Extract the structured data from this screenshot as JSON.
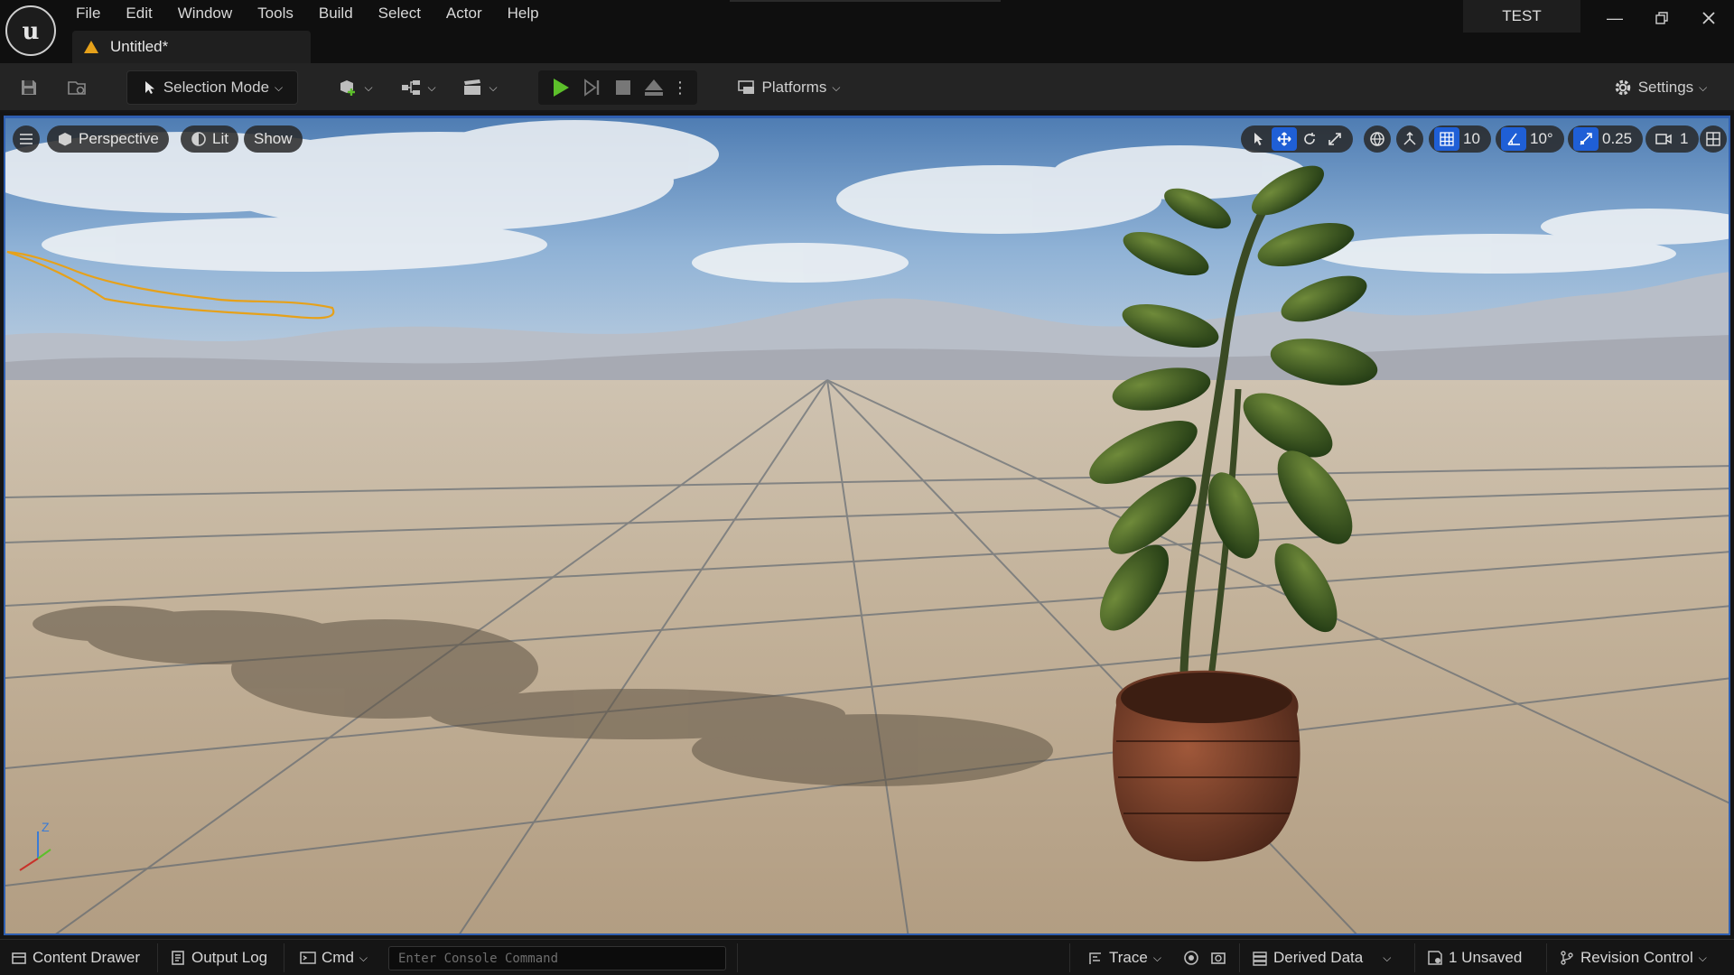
{
  "app": {
    "logo_icon": "unreal-engine-logo-icon",
    "menu": [
      "File",
      "Edit",
      "Window",
      "Tools",
      "Build",
      "Select",
      "Actor",
      "Help"
    ],
    "document_tab": "Untitled*",
    "project_name": "TEST",
    "window_controls": [
      "minimize-icon",
      "restore-icon",
      "close-icon"
    ]
  },
  "toolbar": {
    "selection_mode": "Selection Mode",
    "platforms": "Platforms",
    "settings": "Settings",
    "play_color": "#5cbf2a"
  },
  "viewport": {
    "view_mode_button": "Perspective",
    "lighting_button": "Lit",
    "show_button": "Show",
    "grid_snap_value": "10",
    "rotation_snap_value": "10°",
    "scale_snap_value": "0.25",
    "camera_speed_value": "1",
    "axis_labels": {
      "z": "Z"
    },
    "accent_color": "#1f5fd6",
    "selection_outline_color": "#e6a11a"
  },
  "statusbar": {
    "content_drawer": "Content Drawer",
    "output_log": "Output Log",
    "cmd": "Cmd",
    "console_placeholder": "Enter Console Command",
    "trace": "Trace",
    "derived_data": "Derived Data",
    "unsaved": "1 Unsaved",
    "revision_control": "Revision Control"
  }
}
